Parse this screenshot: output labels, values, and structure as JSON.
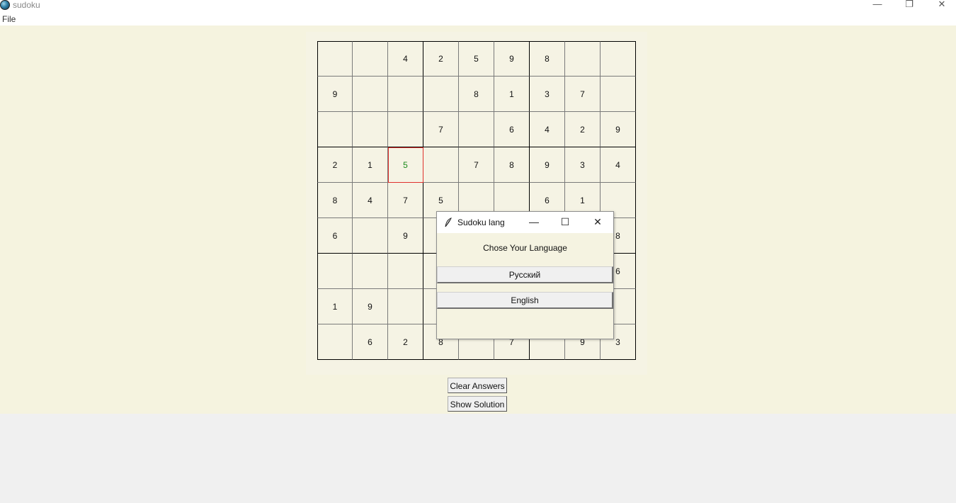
{
  "window": {
    "title": "sudoku",
    "minimize": "—",
    "restore": "❐",
    "close": "✕"
  },
  "menu": {
    "file": "File"
  },
  "board": {
    "rows": [
      [
        "",
        "",
        "4",
        "2",
        "5",
        "9",
        "8",
        "",
        ""
      ],
      [
        "9",
        "",
        "",
        "",
        "8",
        "1",
        "3",
        "7",
        ""
      ],
      [
        "",
        "",
        "",
        "7",
        "",
        "6",
        "4",
        "2",
        "9"
      ],
      [
        "2",
        "1",
        "5",
        "",
        "7",
        "8",
        "9",
        "3",
        "4"
      ],
      [
        "8",
        "4",
        "7",
        "5",
        "",
        "",
        "6",
        "1",
        ""
      ],
      [
        "6",
        "",
        "9",
        "",
        "",
        "",
        "",
        "",
        "8"
      ],
      [
        "",
        "",
        "",
        "",
        "",
        "",
        "",
        "",
        "6"
      ],
      [
        "1",
        "9",
        "",
        "",
        "",
        "",
        "",
        "",
        ""
      ],
      [
        "",
        "6",
        "2",
        "8",
        "",
        "7",
        "",
        "9",
        "3"
      ]
    ],
    "selected": {
      "row": 3,
      "col": 2
    },
    "selected_color": "#e0302c",
    "answer_color": "#1a8a1a"
  },
  "buttons": {
    "clear": "Clear Answers",
    "solution": "Show Solution"
  },
  "dialog": {
    "title": "Sudoku lang",
    "minimize": "—",
    "maximize": "☐",
    "close": "✕",
    "prompt": "Chose Your Language",
    "options": [
      "Русский",
      "English"
    ]
  }
}
